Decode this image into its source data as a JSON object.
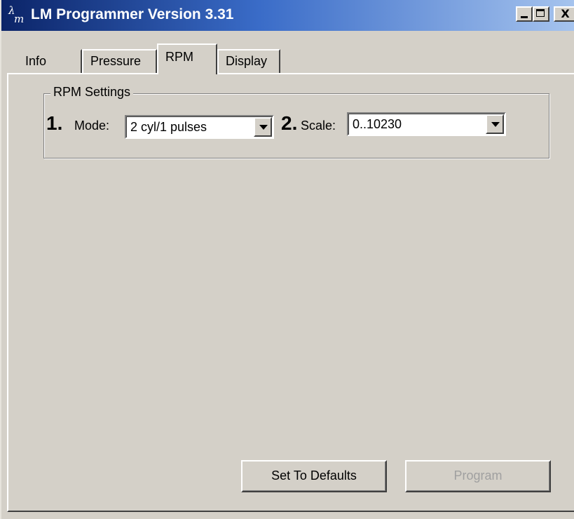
{
  "window": {
    "title": "LM Programmer Version 3.31",
    "controls": {
      "minimize": "minimize-icon",
      "maximize": "maximize-icon",
      "close": "X"
    }
  },
  "tabs": [
    {
      "label": "Info",
      "selected": false
    },
    {
      "label": "Pressure",
      "selected": false
    },
    {
      "label": "RPM",
      "selected": true
    },
    {
      "label": "Display",
      "selected": false
    }
  ],
  "rpm_settings": {
    "group_title": "RPM Settings",
    "mode": {
      "step": "1.",
      "label": "Mode:",
      "value": "2 cyl/1 pulses"
    },
    "scale": {
      "step": "2.",
      "label": "Scale:",
      "value": "0..10230"
    }
  },
  "buttons": {
    "set_defaults": "Set To Defaults",
    "program": "Program",
    "program_enabled": false
  },
  "colors": {
    "title_bar_start": "#0b2468",
    "title_bar_end": "#a6c4ee",
    "face": "#d4d0c8",
    "disabled_text": "#a0a0a0"
  }
}
